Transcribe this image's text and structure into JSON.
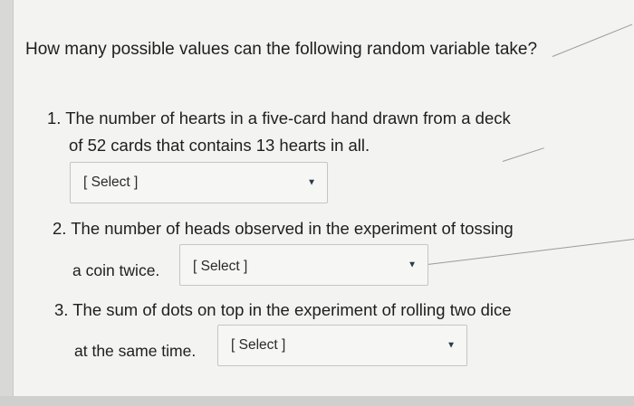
{
  "question": {
    "text": "How many possible values can the following random variable take?"
  },
  "items": [
    {
      "line1": "1. The number of hearts in a five-card hand drawn from a deck",
      "line2": "of 52 cards that contains 13 hearts in all.",
      "select_value": "[ Select ]"
    },
    {
      "line1": "2. The number of heads observed in the experiment of tossing",
      "line2": "a coin twice.",
      "select_value": "[ Select ]"
    },
    {
      "line1": "3. The sum of dots on top in the experiment of rolling two dice",
      "line2": "at the same time.",
      "select_value": "[ Select ]"
    }
  ],
  "icons": {
    "dropdown": "caret-down-icon"
  }
}
